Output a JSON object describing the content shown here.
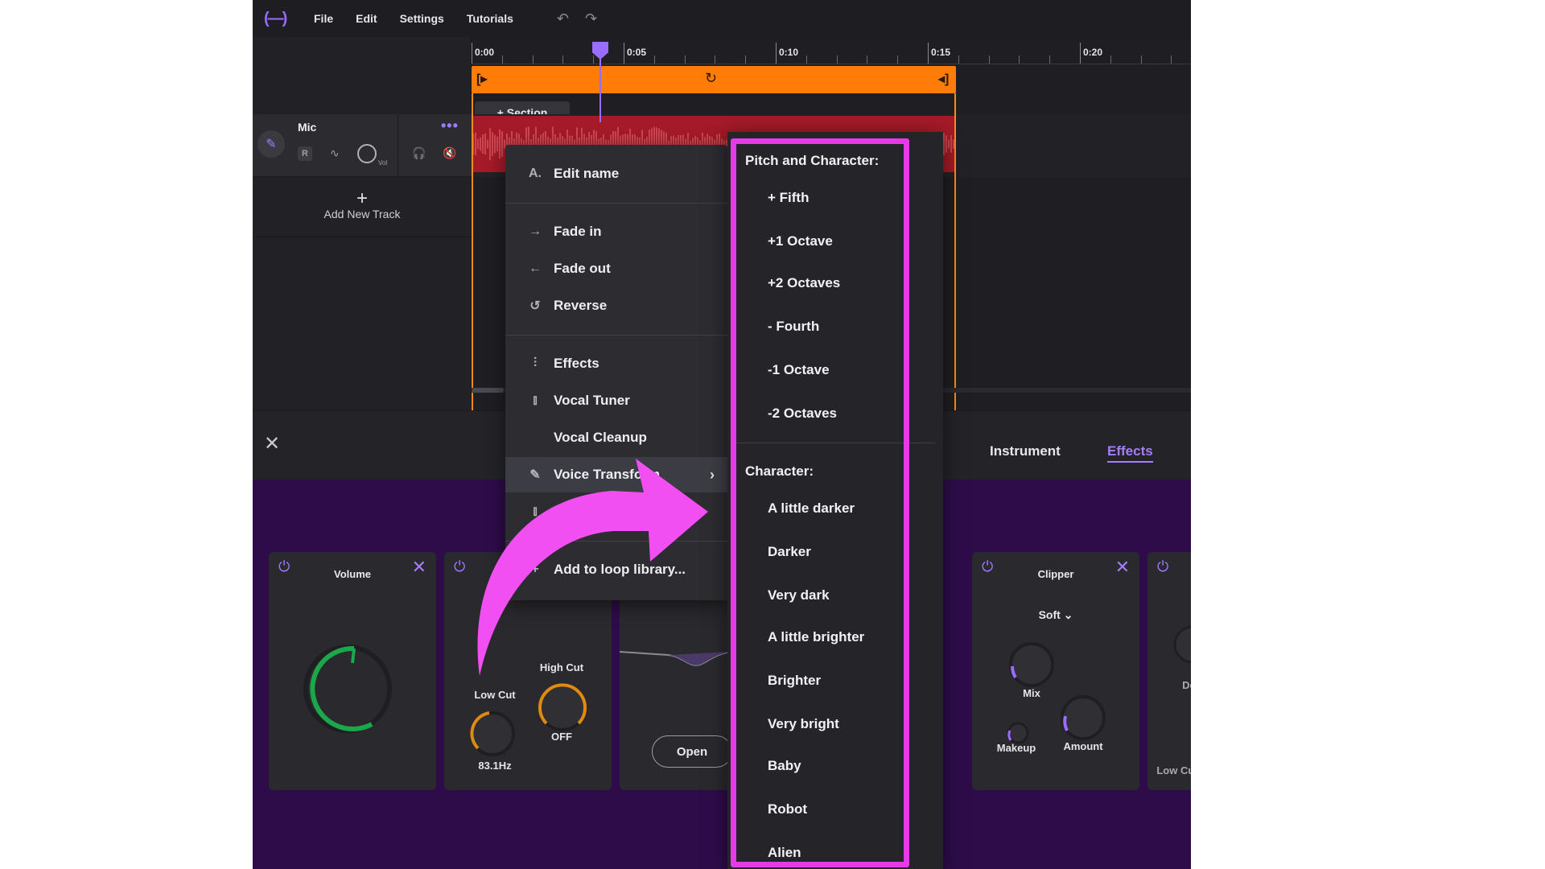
{
  "menubar": {
    "logo": "(—)",
    "items": [
      "File",
      "Edit",
      "Settings",
      "Tutorials"
    ],
    "undo": "↶",
    "redo": "↷"
  },
  "track": {
    "name": "Mic",
    "more": "•••",
    "record": "R",
    "vol_label": "Vol"
  },
  "add_track": {
    "plus": "+",
    "label": "Add New Track"
  },
  "timeline": {
    "ticks": [
      "0:00",
      "0:05",
      "0:10",
      "0:15",
      "0:20"
    ],
    "section_button": "+ Section"
  },
  "context_menu": {
    "edit_name": "Edit name",
    "fade_in": "Fade in",
    "fade_out": "Fade out",
    "reverse": "Reverse",
    "effects": "Effects",
    "vocal_tuner": "Vocal Tuner",
    "vocal_cleanup": "Vocal Cleanup",
    "voice_transform": "Voice Transform",
    "add_to_loop": "Add to loop library..."
  },
  "submenu": {
    "pitch_heading": "Pitch and Character:",
    "pitch_items": [
      "+ Fifth",
      "+1 Octave",
      "+2 Octaves",
      "- Fourth",
      "-1 Octave",
      "-2 Octaves"
    ],
    "character_heading": "Character:",
    "character_items": [
      "A little darker",
      "Darker",
      "Very dark",
      "A little brighter",
      "Brighter",
      "Very bright",
      "Baby",
      "Robot",
      "Alien"
    ]
  },
  "fx_tabs": {
    "instrument": "Instrument",
    "effects": "Effects"
  },
  "fx_cards": {
    "volume_title": "Volume",
    "low_cut": "Low Cut",
    "low_cut_value": "83.1Hz",
    "high_cut": "High Cut",
    "high_cut_value": "OFF",
    "open_button": "Open",
    "clipper_title": "Clipper",
    "clipper_mode": "Soft",
    "mix": "Mix",
    "makeup": "Makeup",
    "amount": "Amount",
    "partial_dec": "Dec",
    "partial_low_cut": "Low Cut"
  },
  "colors": {
    "accent": "#a67cff",
    "loop_bar": "#ff7c08",
    "clip": "#a51a28",
    "highlight": "#e53be6",
    "rack_bg": "#2e0c4a"
  }
}
